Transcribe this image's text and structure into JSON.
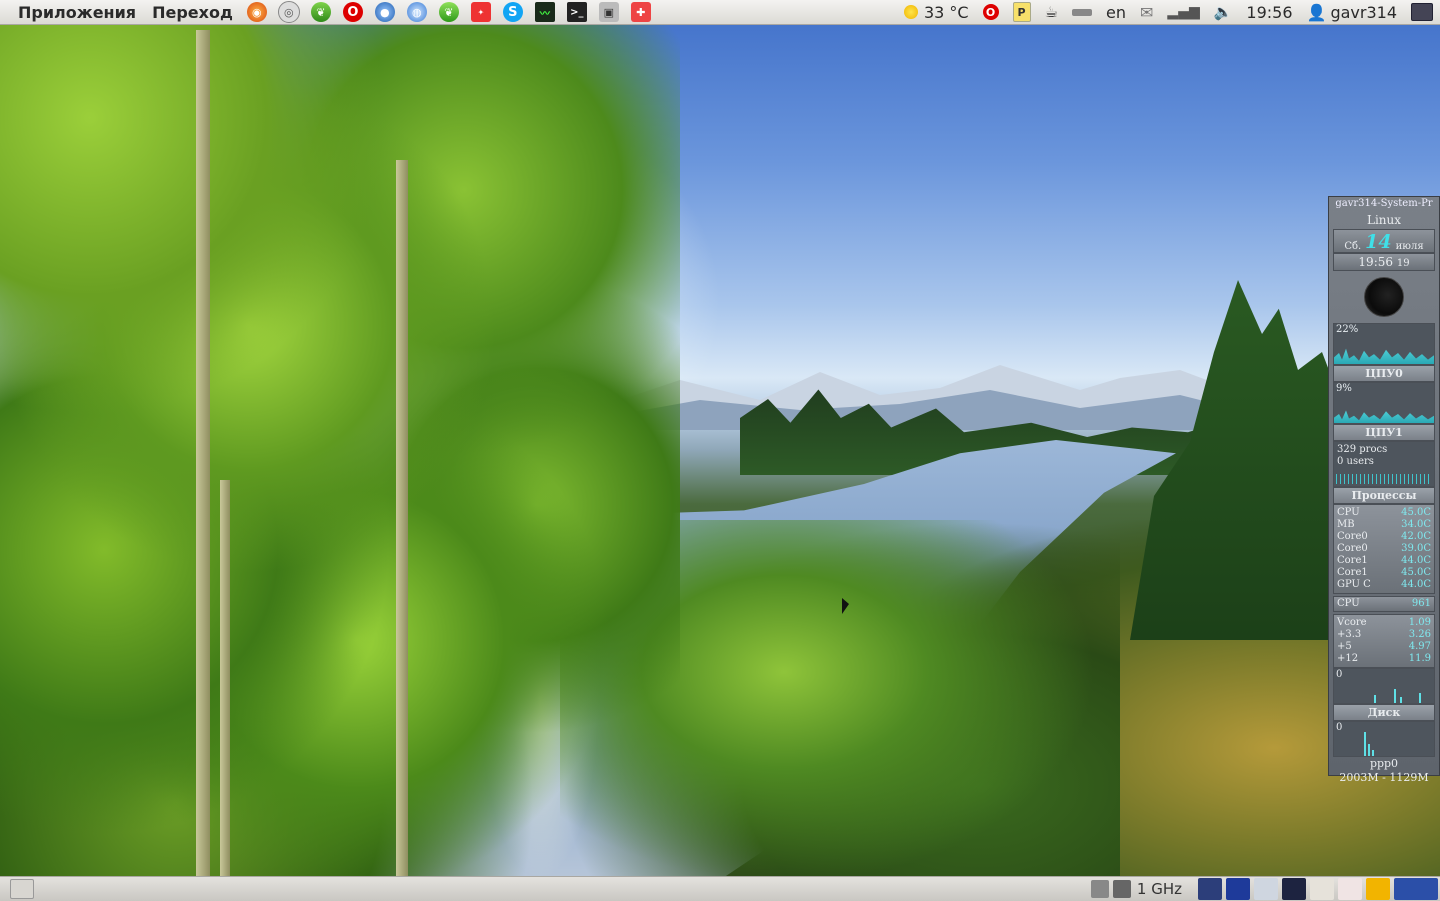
{
  "top_panel": {
    "menus": [
      "Приложения",
      "Переход"
    ],
    "launchers": [
      "firefox-icon",
      "monitor-icon",
      "leaf-icon",
      "opera-icon",
      "disc-icon",
      "browser-icon",
      "leaf2-icon",
      "badge-icon",
      "skype-icon",
      "system-monitor-icon",
      "terminal-icon",
      "camera-icon",
      "app-icon"
    ],
    "weather": "33 °C",
    "keyboard_layout": "en",
    "clock": "19:56",
    "user": "gavr314"
  },
  "bottom_panel": {
    "cpu_freq": "1 GHz"
  },
  "gkrellm": {
    "title": "gavr314-System-Pr",
    "os": "Linux",
    "weekday": "Сб.",
    "day": "14",
    "month": "июля",
    "time": "19:56",
    "seconds": "19",
    "cpu0_percent": "22%",
    "cpu0_label": "ЦПУ0",
    "cpu1_percent": "9%",
    "cpu1_label": "ЦПУ1",
    "procs": "329 procs",
    "users": "0 users",
    "procs_label": "Процессы",
    "sensors": [
      {
        "name": "CPU",
        "value": "45.0C"
      },
      {
        "name": "MB",
        "value": "34.0C"
      },
      {
        "name": "Core0",
        "value": "42.0C"
      },
      {
        "name": "Core0",
        "value": "39.0C"
      },
      {
        "name": "Core1",
        "value": "44.0C"
      },
      {
        "name": "Core1",
        "value": "45.0C"
      },
      {
        "name": "GPU C",
        "value": "44.0C"
      }
    ],
    "fan": {
      "name": "CPU",
      "value": "961"
    },
    "voltages": [
      {
        "name": "Vcore",
        "value": "1.09"
      },
      {
        "name": "+3.3",
        "value": "3.26"
      },
      {
        "name": "+5",
        "value": "4.97"
      },
      {
        "name": "+12",
        "value": "11.9"
      }
    ],
    "disk_value": "0",
    "disk_label": "Диск",
    "net_value": "0",
    "net_label": "ppp0",
    "mem": "2003M - 1129M"
  }
}
